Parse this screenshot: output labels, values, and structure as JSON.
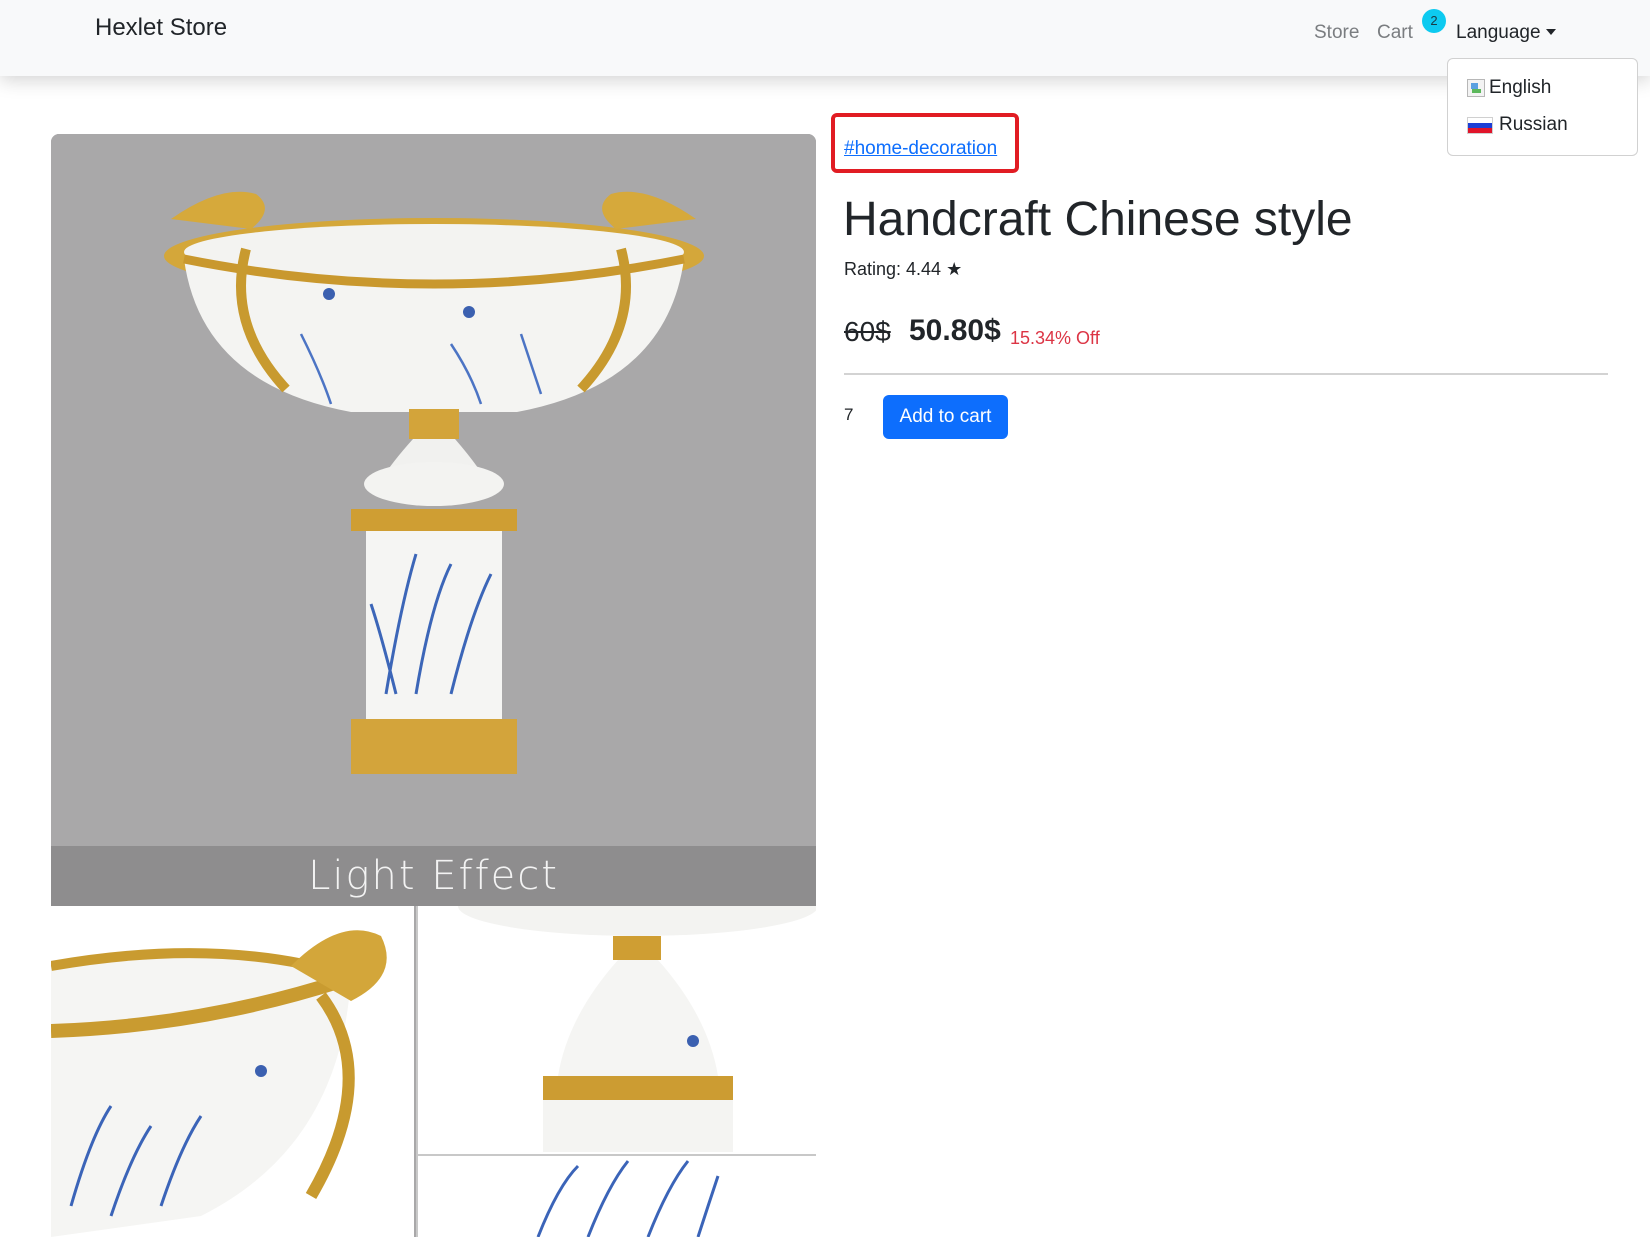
{
  "navbar": {
    "brand": "Hexlet Store",
    "links": {
      "store": "Store",
      "cart": "Cart",
      "language": "Language"
    },
    "cart_count": "2"
  },
  "language_menu": {
    "items": [
      {
        "label": "English",
        "icon": "broken-image-flag-icon"
      },
      {
        "label": "Russian",
        "icon": "russia-flag-icon"
      }
    ]
  },
  "product": {
    "tag": "#home-decoration",
    "title": "Handcraft Chinese style",
    "rating": "Rating: 4.44 ★",
    "price_old": "60$",
    "price_new": "50.80$",
    "discount": "15.34% Off",
    "quantity": "7",
    "add_to_cart": "Add to cart",
    "image_caption": "Light Effect"
  },
  "colors": {
    "accent": "#0d6efd",
    "discount": "#dc3545",
    "badge": "#0dcaf0",
    "highlight": "#e11c23"
  }
}
